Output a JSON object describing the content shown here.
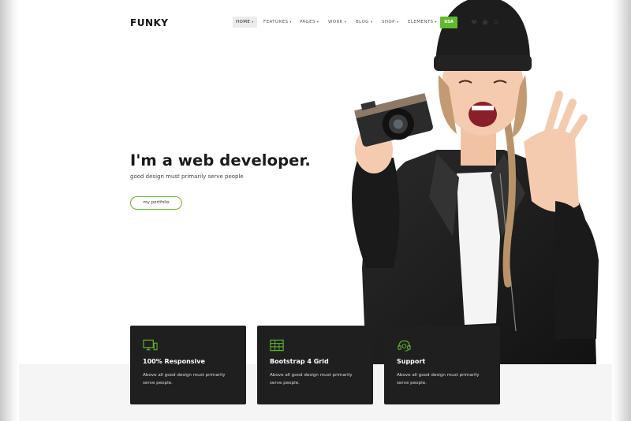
{
  "header": {
    "logo": "FUNKY",
    "nav": [
      {
        "label": "HOME",
        "caret": "▾"
      },
      {
        "label": "FEATURES",
        "caret": "▾"
      },
      {
        "label": "PAGES",
        "caret": "▾"
      },
      {
        "label": "WORK",
        "caret": "▾"
      },
      {
        "label": "BLOG",
        "caret": "▾"
      },
      {
        "label": "SHOP",
        "caret": "▾"
      },
      {
        "label": "ELEMENTS",
        "caret": "▾"
      }
    ],
    "buy_label": "USA",
    "icons": [
      "heart-icon",
      "cart-icon",
      "search-icon"
    ]
  },
  "hero": {
    "title": "I'm a web developer.",
    "subtitle": "good design must primarily serve people",
    "button_label": "my portfolio"
  },
  "features": [
    {
      "icon": "monitor-icon",
      "title": "100% Responsive",
      "text": "Above all good design must primarily serve people."
    },
    {
      "icon": "grid-icon",
      "title": "Bootstrap 4 Grid",
      "text": "Above all good design must primarily serve people."
    },
    {
      "icon": "headset-icon",
      "title": "Support",
      "text": "Above all good design must primarily serve people."
    }
  ],
  "colors": {
    "accent": "#5fba2c",
    "card_bg": "#1f1f1f",
    "text_dark": "#1a1a1a"
  }
}
